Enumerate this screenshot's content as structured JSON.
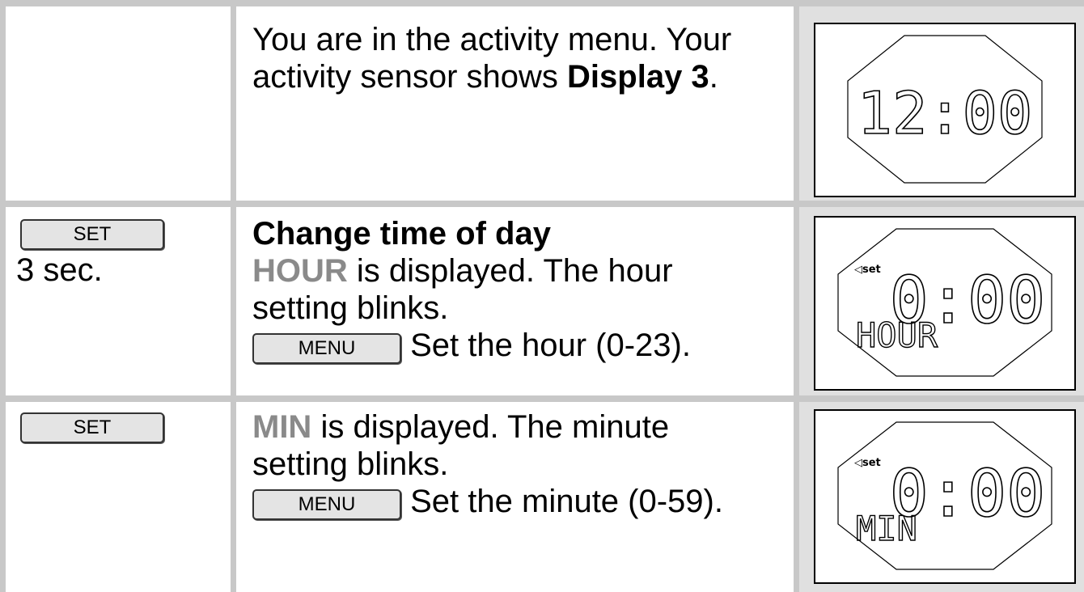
{
  "rows": [
    {
      "button": null,
      "duration": null,
      "text": {
        "line1": "You are in the activity menu. Your",
        "line2_prefix": "activity sensor shows ",
        "line2_bold": "Display 3",
        "line2_suffix": "."
      },
      "display": {
        "digits": "12:00",
        "label": ""
      }
    },
    {
      "button": "SET",
      "duration": "3 sec.",
      "text": {
        "heading": "Change time of day",
        "keyword": "HOUR",
        "line1_rest": [
          "is",
          "displayed.",
          "The",
          "hour"
        ],
        "line2": "setting blinks.",
        "menu_button": "MENU",
        "menu_action": "Set the hour (0-23)."
      },
      "display": {
        "set_indicator": "◁set",
        "digits": "0:00",
        "label": "HOUR"
      }
    },
    {
      "button": "SET",
      "duration": null,
      "text": {
        "keyword": "MIN",
        "line1_rest": [
          "is",
          "displayed.",
          "The",
          "minute"
        ],
        "line2": "setting blinks.",
        "menu_button": "MENU",
        "menu_action": "Set the minute (0-59)."
      },
      "display": {
        "set_indicator": "◁set",
        "digits": "0:00",
        "label": "MIN"
      }
    }
  ]
}
